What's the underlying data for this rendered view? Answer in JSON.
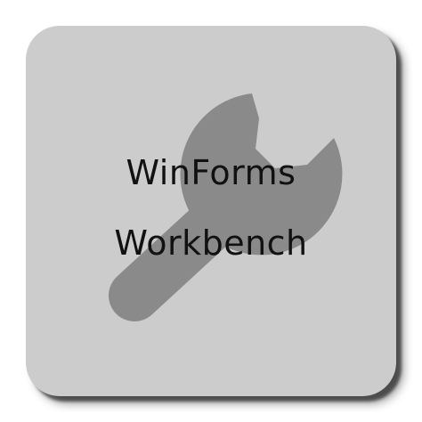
{
  "app_icon": {
    "title_line_1": "WinForms",
    "title_line_2": "Workbench",
    "icon": "wrench-icon",
    "colors": {
      "tile_background": "#cccccc",
      "wrench": "#8a8a8a",
      "text": "#111111"
    }
  }
}
